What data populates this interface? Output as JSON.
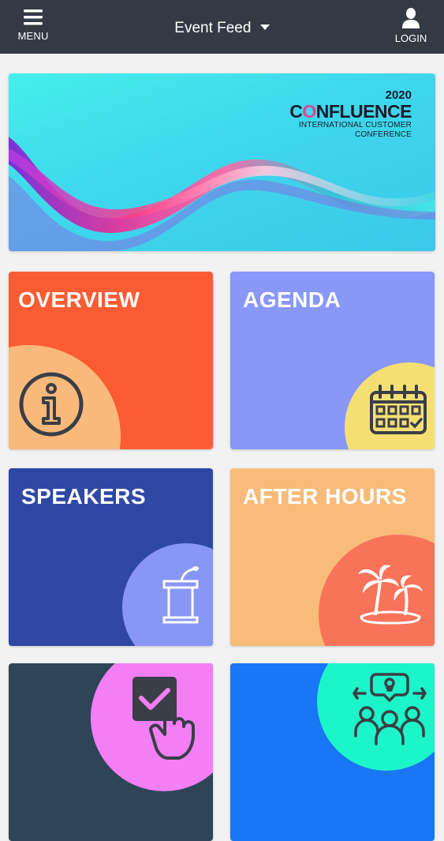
{
  "header": {
    "menu_label": "MENU",
    "feed_title": "Event Feed",
    "login_label": "LOGIN"
  },
  "banner": {
    "year": "2020",
    "brand_pre": "C",
    "brand_o": "O",
    "brand_post": "NFLUENCE",
    "subtitle_line1": "INTERNATIONAL CUSTOMER",
    "subtitle_line2": "CONFERENCE"
  },
  "tiles": [
    {
      "label": "OVERVIEW",
      "bg": "#fb5c33",
      "circle": "#f9b97b",
      "icon": "info-icon"
    },
    {
      "label": "AGENDA",
      "bg": "#8897f8",
      "circle": "#f5df73",
      "icon": "calendar-icon"
    },
    {
      "label": "SPEAKERS",
      "bg": "#2f48a6",
      "circle": "#8896f6",
      "icon": "podium-icon"
    },
    {
      "label": "AFTER HOURS",
      "bg": "#f8bb79",
      "circle": "#f8735a",
      "icon": "palm-island-icon"
    },
    {
      "label": "",
      "bg": "#2e4558",
      "circle": "#f47ef3",
      "icon": "vote-checkbox-icon"
    },
    {
      "label": "",
      "bg": "#1976f4",
      "circle": "#1cf5c8",
      "icon": "community-icon"
    }
  ]
}
